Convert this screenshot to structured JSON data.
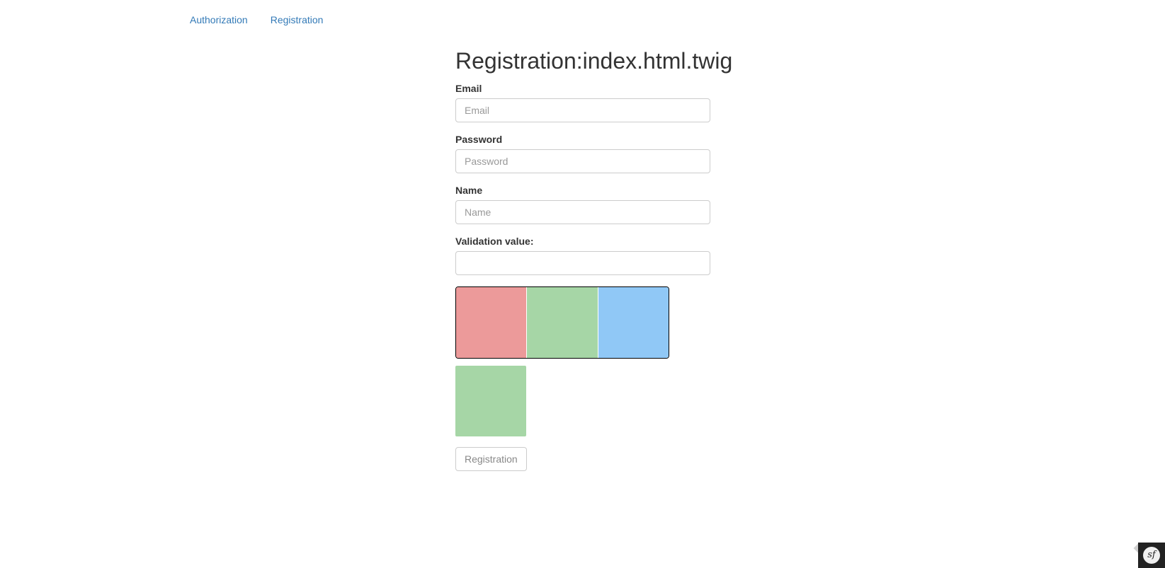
{
  "nav": {
    "items": [
      {
        "label": "Authorization"
      },
      {
        "label": "Registration"
      }
    ]
  },
  "page": {
    "title": "Registration:index.html.twig"
  },
  "form": {
    "email": {
      "label": "Email",
      "placeholder": "Email",
      "value": ""
    },
    "password": {
      "label": "Password",
      "placeholder": "Password",
      "value": ""
    },
    "name": {
      "label": "Name",
      "placeholder": "Name",
      "value": ""
    },
    "validation": {
      "label": "Validation value:",
      "placeholder": "",
      "value": ""
    },
    "submit_label": "Registration"
  },
  "captcha": {
    "swatches": [
      {
        "name": "red",
        "color": "#ec9a9a"
      },
      {
        "name": "green",
        "color": "#a6d6a6"
      },
      {
        "name": "blue",
        "color": "#90c8f6"
      }
    ],
    "selected": {
      "name": "green",
      "color": "#a6d6a6"
    }
  },
  "toolbar": {
    "logo_text": "sf",
    "background": "#222222"
  }
}
